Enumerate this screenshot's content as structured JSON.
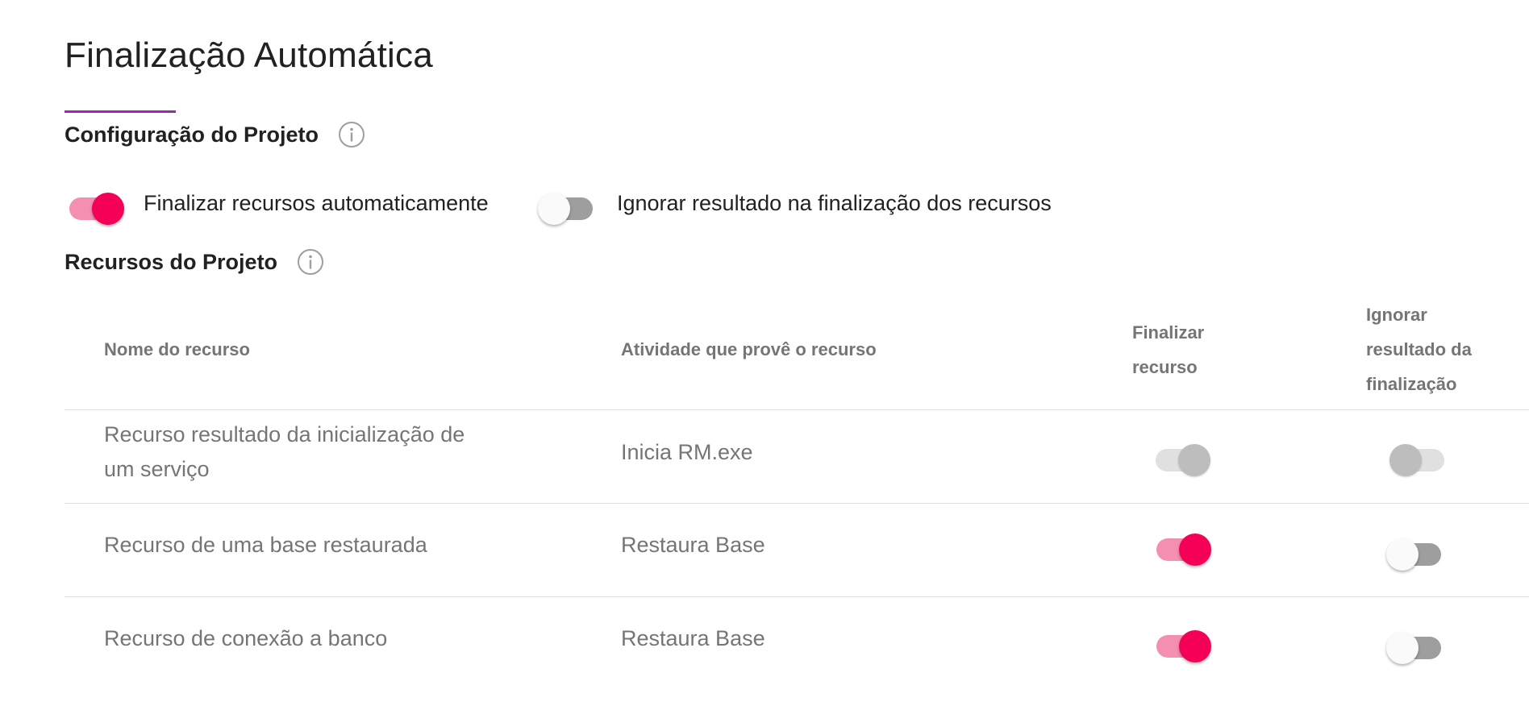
{
  "page": {
    "title": "Finalização Automática",
    "accent_color": "#9c27b0"
  },
  "project_config": {
    "title": "Configuração do Projeto",
    "info_icon": "info-icon",
    "toggles": [
      {
        "label": "Finalizar recursos automaticamente",
        "checked": true
      },
      {
        "label": "Ignorar resultado na finalização dos recursos",
        "checked": false
      }
    ]
  },
  "project_resources": {
    "title": "Recursos do Projeto",
    "info_icon": "info-icon",
    "table": {
      "headers": {
        "name": "Nome do recurso",
        "activity": "Atividade que provê o recurso",
        "finalize_line1": "Finalizar",
        "finalize_line2": "recurso",
        "ignore_line1": "Ignorar",
        "ignore_line2": "resultado da",
        "ignore_line3": "finalização"
      },
      "rows": [
        {
          "name_line1": "Recurso resultado da inicialização de",
          "name_line2": "um serviço",
          "activity": "Inicia RM.exe",
          "finalize": "on-disabled",
          "ignore": "off-disabled"
        },
        {
          "name_line1": "Recurso de uma base restaurada",
          "name_line2": "",
          "activity": "Restaura Base",
          "finalize": "on",
          "ignore": "off"
        },
        {
          "name_line1": "Recurso de conexão a banco",
          "name_line2": "",
          "activity": "Restaura Base",
          "finalize": "on",
          "ignore": "off"
        }
      ]
    }
  },
  "colors": {
    "toggle_on_thumb": "#f50057",
    "toggle_on_track": "#f48fb1",
    "toggle_off_track": "#9e9e9e",
    "disabled": "#bdbdbd"
  }
}
